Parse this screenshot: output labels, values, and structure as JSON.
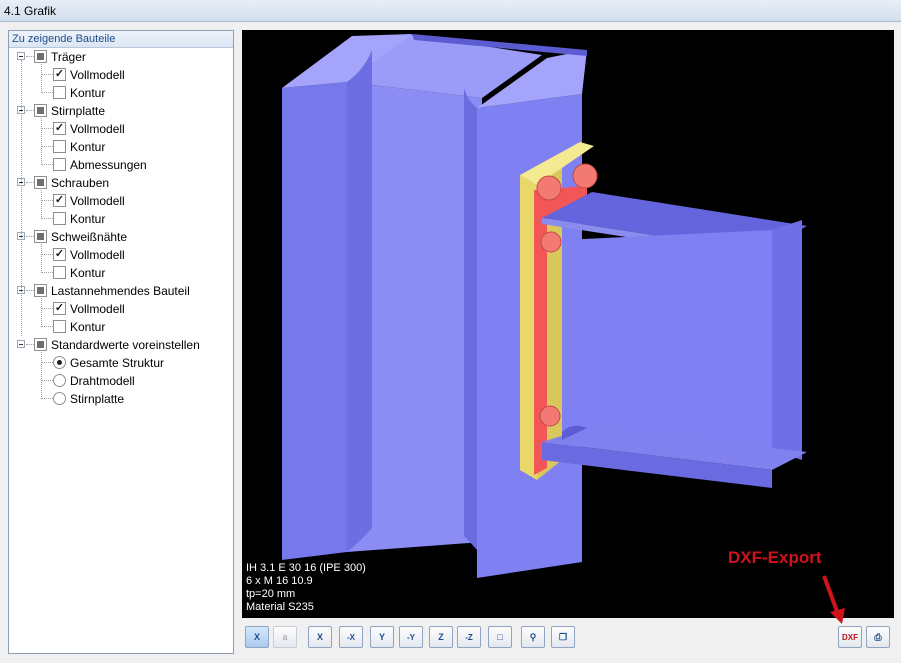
{
  "window": {
    "title": "4.1 Grafik"
  },
  "panel": {
    "header": "Zu zeigende Bauteile",
    "groups": [
      {
        "label": "Träger",
        "items": [
          {
            "label": "Vollmodell",
            "checked": true
          },
          {
            "label": "Kontur",
            "checked": false
          }
        ]
      },
      {
        "label": "Stirnplatte",
        "items": [
          {
            "label": "Vollmodell",
            "checked": true
          },
          {
            "label": "Kontur",
            "checked": false
          },
          {
            "label": "Abmessungen",
            "checked": false
          }
        ]
      },
      {
        "label": "Schrauben",
        "items": [
          {
            "label": "Vollmodell",
            "checked": true
          },
          {
            "label": "Kontur",
            "checked": false
          }
        ]
      },
      {
        "label": "Schweißnähte",
        "items": [
          {
            "label": "Vollmodell",
            "checked": true
          },
          {
            "label": "Kontur",
            "checked": false
          }
        ]
      },
      {
        "label": "Lastannehmendes Bauteil",
        "items": [
          {
            "label": "Vollmodell",
            "checked": true
          },
          {
            "label": "Kontur",
            "checked": false
          }
        ]
      },
      {
        "label": "Standardwerte voreinstellen",
        "radios": [
          {
            "label": "Gesamte Struktur",
            "selected": true
          },
          {
            "label": "Drahtmodell",
            "selected": false
          },
          {
            "label": "Stirnplatte",
            "selected": false
          }
        ]
      }
    ]
  },
  "view": {
    "info_lines": [
      "IH 3.1 E 30 16  (IPE 300)",
      "6 x M 16 10.9",
      "tp=20 mm",
      "Material S235"
    ],
    "colors": {
      "beam": "#7f80f2",
      "beam_dark": "#5e5fd6",
      "plate": "#ecdd74",
      "weld": "#f25656",
      "bolt": "#f27a72",
      "background": "#000000"
    }
  },
  "annotation": {
    "label": "DXF-Export",
    "color": "#d0121b"
  },
  "toolbar": {
    "buttons": [
      {
        "label": "X"
      },
      {
        "label": "a"
      },
      {
        "label": "X"
      },
      {
        "label": "-X"
      },
      {
        "label": "Y"
      },
      {
        "label": "-Y"
      },
      {
        "label": "Z"
      },
      {
        "label": "-Z"
      },
      {
        "label": ""
      },
      {
        "label": ""
      },
      {
        "label": ""
      },
      {
        "label": "DXF"
      },
      {
        "label": ""
      }
    ]
  }
}
